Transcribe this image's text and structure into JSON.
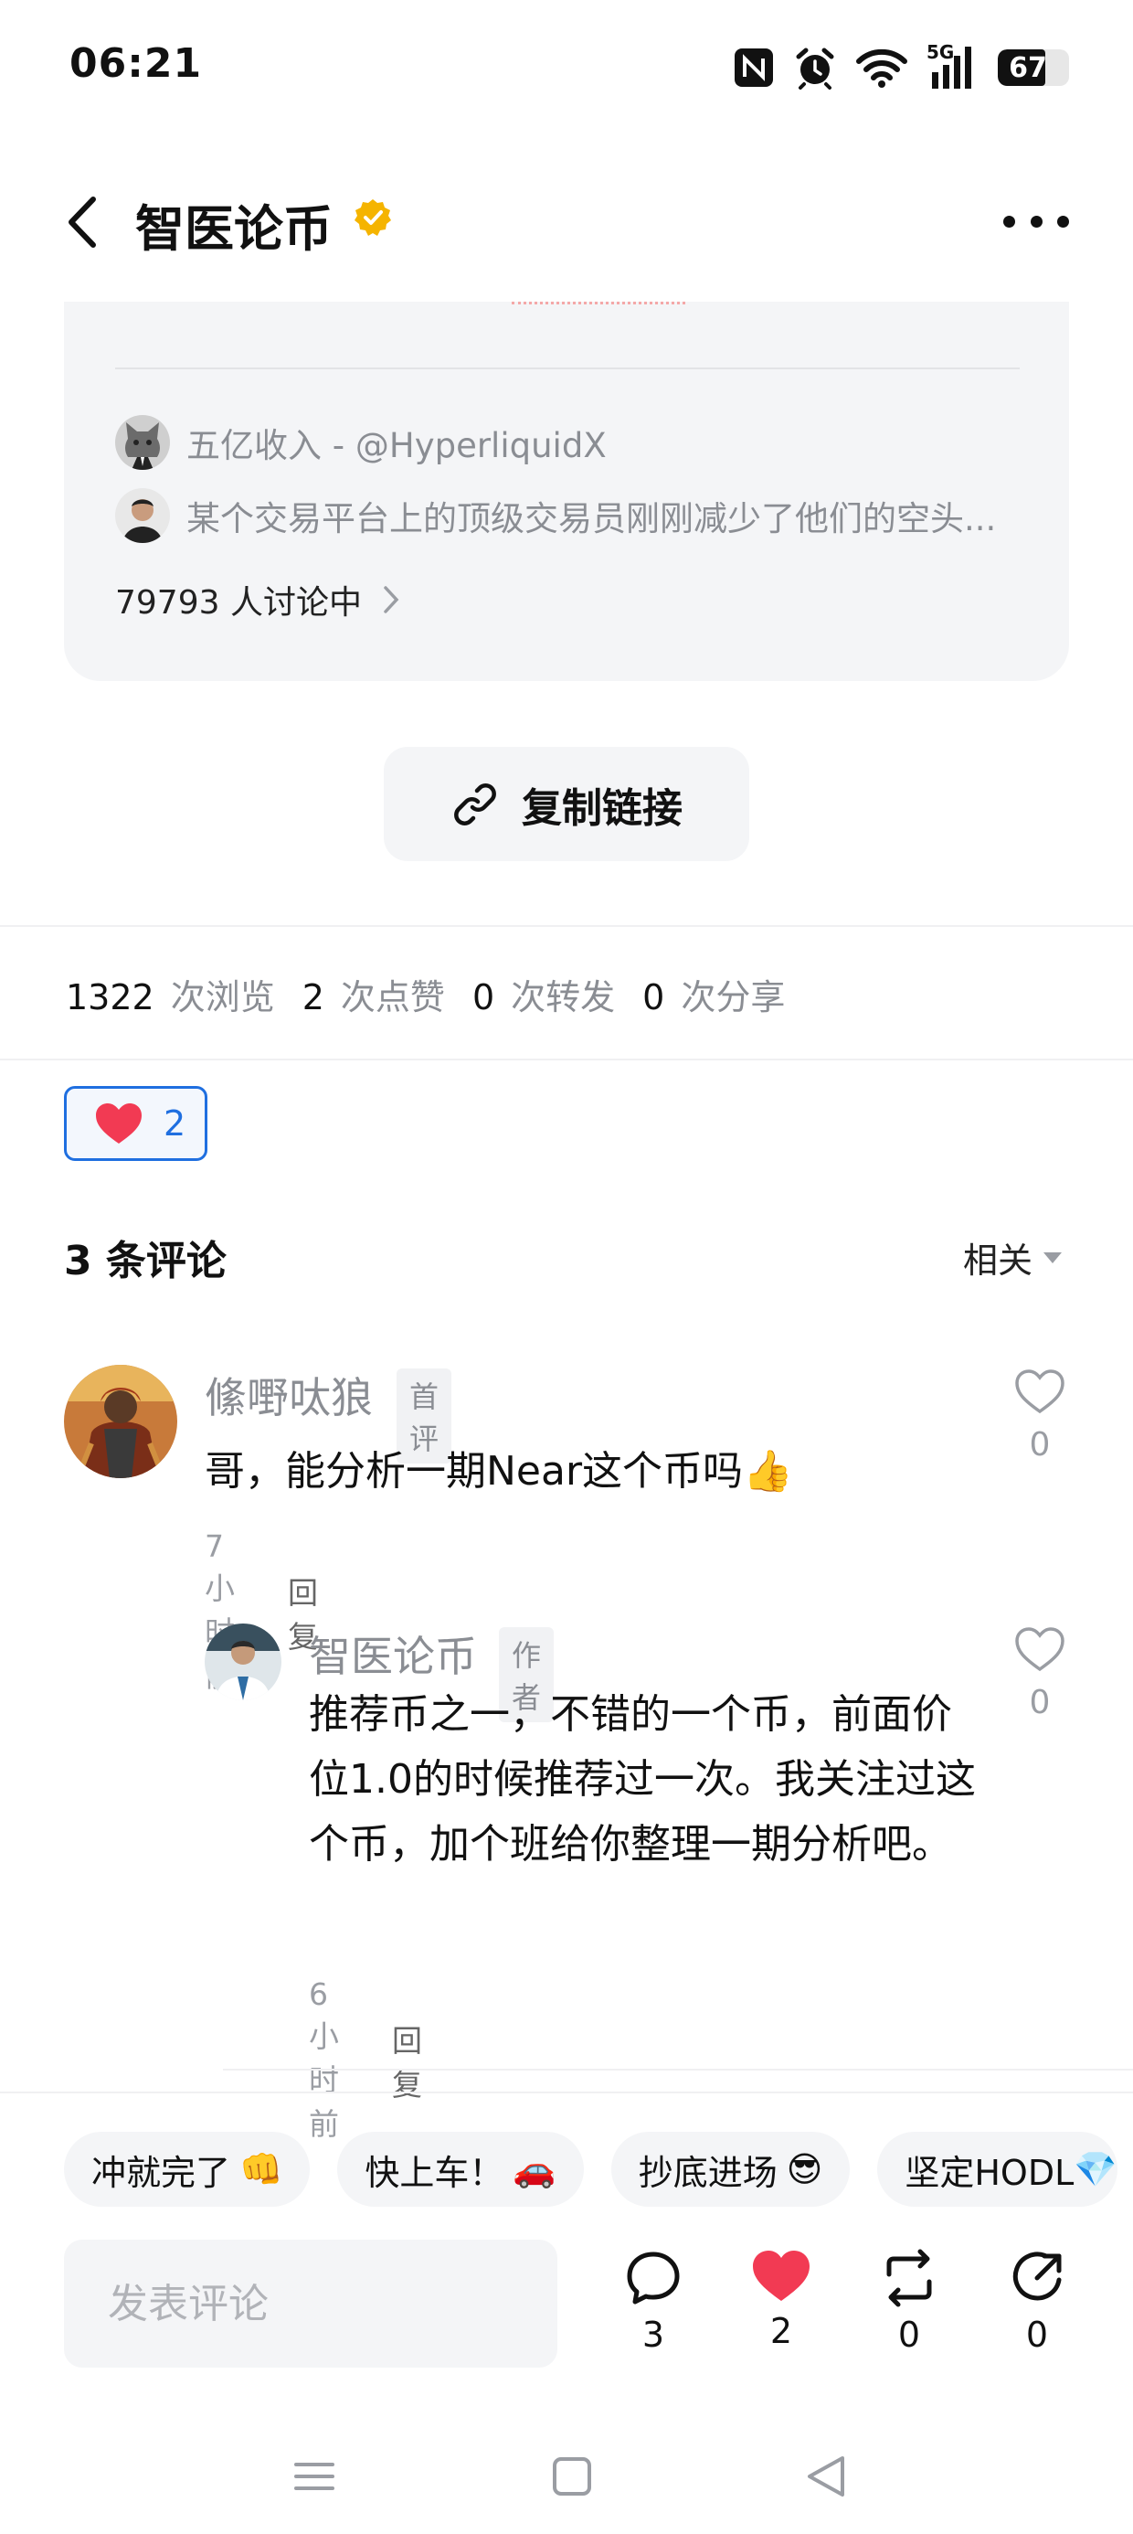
{
  "status_bar": {
    "time": "06:21",
    "signal_label": "5G",
    "battery": "67",
    "battery_level": 0.67,
    "icons": [
      "nfc-icon",
      "alarm-icon",
      "wifi-icon",
      "signal-5g-icon",
      "battery-icon"
    ]
  },
  "header": {
    "title": "智医论币",
    "verified_icon": "verified-badge-icon",
    "more_icon": "more-dots-icon"
  },
  "quoted_card": {
    "repost_line": "五亿收入 - @HyperliquidX",
    "snippet": "某个交易平台上的顶级交易员刚刚减少了他们的空头...",
    "discussion": "79793 人讨论中"
  },
  "copy_link": {
    "label": "复制链接"
  },
  "stats": {
    "views": "1322",
    "views_label": "次浏览",
    "likes": "2",
    "likes_label": "次点赞",
    "reposts": "0",
    "reposts_label": "次转发",
    "shares": "0",
    "shares_label": "次分享"
  },
  "like_chip": {
    "count": "2"
  },
  "comments": {
    "title": "3 条评论",
    "sort_label": "相关",
    "items": [
      {
        "author": "絛嘢呔狼",
        "badge": "首评",
        "text": "哥，能分析一期Near这个币吗👍",
        "time": "7 小时前",
        "reply_label": "回复",
        "likes": "0"
      },
      {
        "author": "智医论币",
        "badge": "作者",
        "text": "推荐币之一，不错的一个币，前面价位1.0的时候推荐过一次。我关注过这个币，加个班给你整理一期分析吧。",
        "time": "6 小时前",
        "reply_label": "回复",
        "likes": "0"
      }
    ]
  },
  "quick_replies": [
    {
      "label": "冲就完了",
      "emoji": "👊"
    },
    {
      "label": "快上车！",
      "emoji": "🚗"
    },
    {
      "label": "抄底进场",
      "emoji": "😎"
    },
    {
      "label": "坚定HODL",
      "emoji": "💎"
    }
  ],
  "composer": {
    "placeholder": "发表评论",
    "actions": [
      {
        "icon": "comment-bubble-icon",
        "count": "3"
      },
      {
        "icon": "heart-filled-icon",
        "count": "2"
      },
      {
        "icon": "repost-icon",
        "count": "0"
      },
      {
        "icon": "share-icon",
        "count": "0"
      }
    ]
  },
  "colors": {
    "accent_blue": "#1f6fe0",
    "like_red": "#f23a53",
    "verified_gold": "#f5b400",
    "card_bg": "#f4f5f7",
    "muted_text": "#8a8d93"
  }
}
